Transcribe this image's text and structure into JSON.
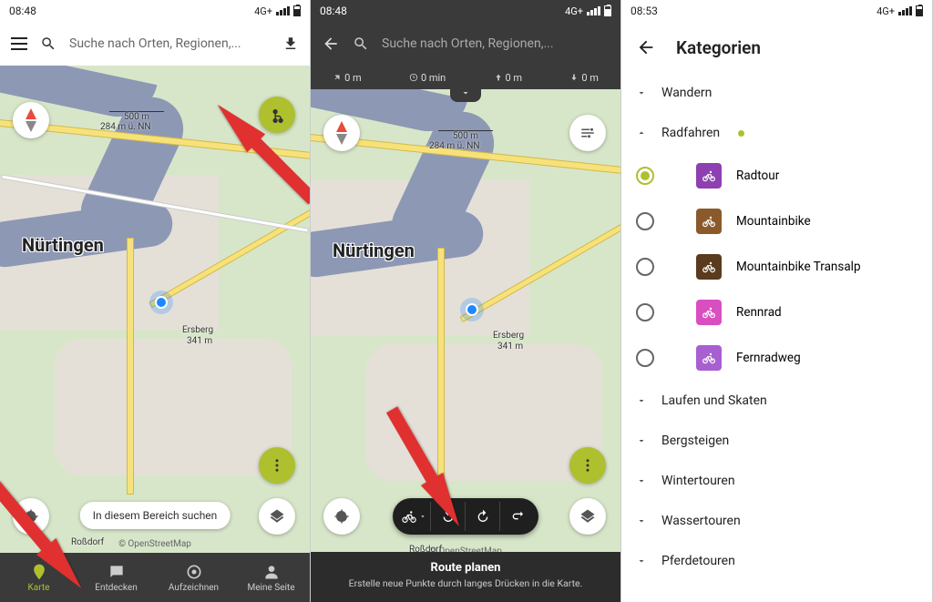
{
  "screens": {
    "s1": {
      "status": {
        "time": "08:48",
        "net": "4G+"
      },
      "search_placeholder": "Suche nach Orten, Regionen,...",
      "city": "Nürtingen",
      "scale": "500 m",
      "elevation": "284 m ü. NN",
      "peak": {
        "name": "Ersberg",
        "height": "341 m"
      },
      "search_area_btn": "In diesem Bereich suchen",
      "attribution": "© OpenStreetMap",
      "tabs": [
        "Karte",
        "Entdecken",
        "Aufzeichnen",
        "Meine Seite"
      ]
    },
    "s2": {
      "status": {
        "time": "08:48",
        "net": "4G+"
      },
      "search_placeholder": "Suche nach Orten, Regionen,...",
      "stats": {
        "dist": "0 m",
        "time": "0 min",
        "asc": "0 m",
        "desc": "0 m"
      },
      "city": "Nürtingen",
      "scale": "500 m",
      "elevation": "284 m ü. NN",
      "peak": {
        "name": "Ersberg",
        "height": "341 m"
      },
      "attribution": "© OpenStreetMap",
      "banner_title": "Route planen",
      "banner_sub": "Erstelle neue Punkte durch langes Drücken in die Karte."
    },
    "s3": {
      "status": {
        "time": "08:53",
        "net": "4G+"
      },
      "header": "Kategorien",
      "groups": {
        "wandern": "Wandern",
        "radfahren": "Radfahren",
        "laufen": "Laufen und Skaten",
        "bergsteigen": "Bergsteigen",
        "winter": "Wintertouren",
        "wasser": "Wassertouren",
        "pferde": "Pferdetouren"
      },
      "rad_items": [
        {
          "label": "Radtour",
          "color": "#8e3fb0",
          "selected": true
        },
        {
          "label": "Mountainbike",
          "color": "#8b5a2b",
          "selected": false
        },
        {
          "label": "Mountainbike Transalp",
          "color": "#5a3b1e",
          "selected": false
        },
        {
          "label": "Rennrad",
          "color": "#d94fc1",
          "selected": false
        },
        {
          "label": "Fernradweg",
          "color": "#a85fd0",
          "selected": false
        }
      ]
    }
  }
}
